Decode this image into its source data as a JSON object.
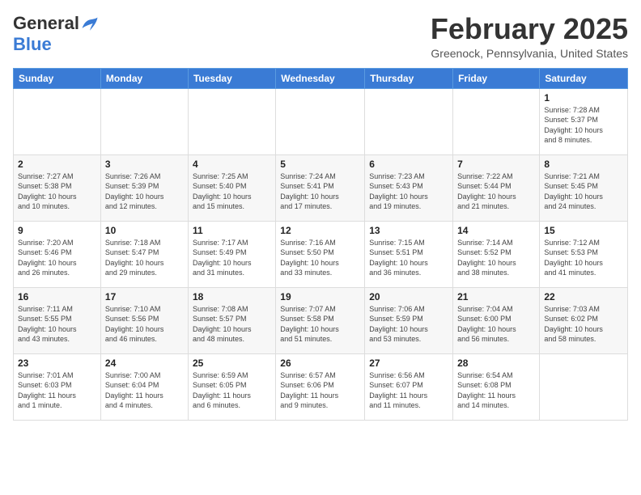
{
  "header": {
    "logo_general": "General",
    "logo_blue": "Blue",
    "month_title": "February 2025",
    "location": "Greenock, Pennsylvania, United States"
  },
  "weekdays": [
    "Sunday",
    "Monday",
    "Tuesday",
    "Wednesday",
    "Thursday",
    "Friday",
    "Saturday"
  ],
  "weeks": [
    [
      {
        "day": "",
        "info": ""
      },
      {
        "day": "",
        "info": ""
      },
      {
        "day": "",
        "info": ""
      },
      {
        "day": "",
        "info": ""
      },
      {
        "day": "",
        "info": ""
      },
      {
        "day": "",
        "info": ""
      },
      {
        "day": "1",
        "info": "Sunrise: 7:28 AM\nSunset: 5:37 PM\nDaylight: 10 hours\nand 8 minutes."
      }
    ],
    [
      {
        "day": "2",
        "info": "Sunrise: 7:27 AM\nSunset: 5:38 PM\nDaylight: 10 hours\nand 10 minutes."
      },
      {
        "day": "3",
        "info": "Sunrise: 7:26 AM\nSunset: 5:39 PM\nDaylight: 10 hours\nand 12 minutes."
      },
      {
        "day": "4",
        "info": "Sunrise: 7:25 AM\nSunset: 5:40 PM\nDaylight: 10 hours\nand 15 minutes."
      },
      {
        "day": "5",
        "info": "Sunrise: 7:24 AM\nSunset: 5:41 PM\nDaylight: 10 hours\nand 17 minutes."
      },
      {
        "day": "6",
        "info": "Sunrise: 7:23 AM\nSunset: 5:43 PM\nDaylight: 10 hours\nand 19 minutes."
      },
      {
        "day": "7",
        "info": "Sunrise: 7:22 AM\nSunset: 5:44 PM\nDaylight: 10 hours\nand 21 minutes."
      },
      {
        "day": "8",
        "info": "Sunrise: 7:21 AM\nSunset: 5:45 PM\nDaylight: 10 hours\nand 24 minutes."
      }
    ],
    [
      {
        "day": "9",
        "info": "Sunrise: 7:20 AM\nSunset: 5:46 PM\nDaylight: 10 hours\nand 26 minutes."
      },
      {
        "day": "10",
        "info": "Sunrise: 7:18 AM\nSunset: 5:47 PM\nDaylight: 10 hours\nand 29 minutes."
      },
      {
        "day": "11",
        "info": "Sunrise: 7:17 AM\nSunset: 5:49 PM\nDaylight: 10 hours\nand 31 minutes."
      },
      {
        "day": "12",
        "info": "Sunrise: 7:16 AM\nSunset: 5:50 PM\nDaylight: 10 hours\nand 33 minutes."
      },
      {
        "day": "13",
        "info": "Sunrise: 7:15 AM\nSunset: 5:51 PM\nDaylight: 10 hours\nand 36 minutes."
      },
      {
        "day": "14",
        "info": "Sunrise: 7:14 AM\nSunset: 5:52 PM\nDaylight: 10 hours\nand 38 minutes."
      },
      {
        "day": "15",
        "info": "Sunrise: 7:12 AM\nSunset: 5:53 PM\nDaylight: 10 hours\nand 41 minutes."
      }
    ],
    [
      {
        "day": "16",
        "info": "Sunrise: 7:11 AM\nSunset: 5:55 PM\nDaylight: 10 hours\nand 43 minutes."
      },
      {
        "day": "17",
        "info": "Sunrise: 7:10 AM\nSunset: 5:56 PM\nDaylight: 10 hours\nand 46 minutes."
      },
      {
        "day": "18",
        "info": "Sunrise: 7:08 AM\nSunset: 5:57 PM\nDaylight: 10 hours\nand 48 minutes."
      },
      {
        "day": "19",
        "info": "Sunrise: 7:07 AM\nSunset: 5:58 PM\nDaylight: 10 hours\nand 51 minutes."
      },
      {
        "day": "20",
        "info": "Sunrise: 7:06 AM\nSunset: 5:59 PM\nDaylight: 10 hours\nand 53 minutes."
      },
      {
        "day": "21",
        "info": "Sunrise: 7:04 AM\nSunset: 6:00 PM\nDaylight: 10 hours\nand 56 minutes."
      },
      {
        "day": "22",
        "info": "Sunrise: 7:03 AM\nSunset: 6:02 PM\nDaylight: 10 hours\nand 58 minutes."
      }
    ],
    [
      {
        "day": "23",
        "info": "Sunrise: 7:01 AM\nSunset: 6:03 PM\nDaylight: 11 hours\nand 1 minute."
      },
      {
        "day": "24",
        "info": "Sunrise: 7:00 AM\nSunset: 6:04 PM\nDaylight: 11 hours\nand 4 minutes."
      },
      {
        "day": "25",
        "info": "Sunrise: 6:59 AM\nSunset: 6:05 PM\nDaylight: 11 hours\nand 6 minutes."
      },
      {
        "day": "26",
        "info": "Sunrise: 6:57 AM\nSunset: 6:06 PM\nDaylight: 11 hours\nand 9 minutes."
      },
      {
        "day": "27",
        "info": "Sunrise: 6:56 AM\nSunset: 6:07 PM\nDaylight: 11 hours\nand 11 minutes."
      },
      {
        "day": "28",
        "info": "Sunrise: 6:54 AM\nSunset: 6:08 PM\nDaylight: 11 hours\nand 14 minutes."
      },
      {
        "day": "",
        "info": ""
      }
    ]
  ]
}
